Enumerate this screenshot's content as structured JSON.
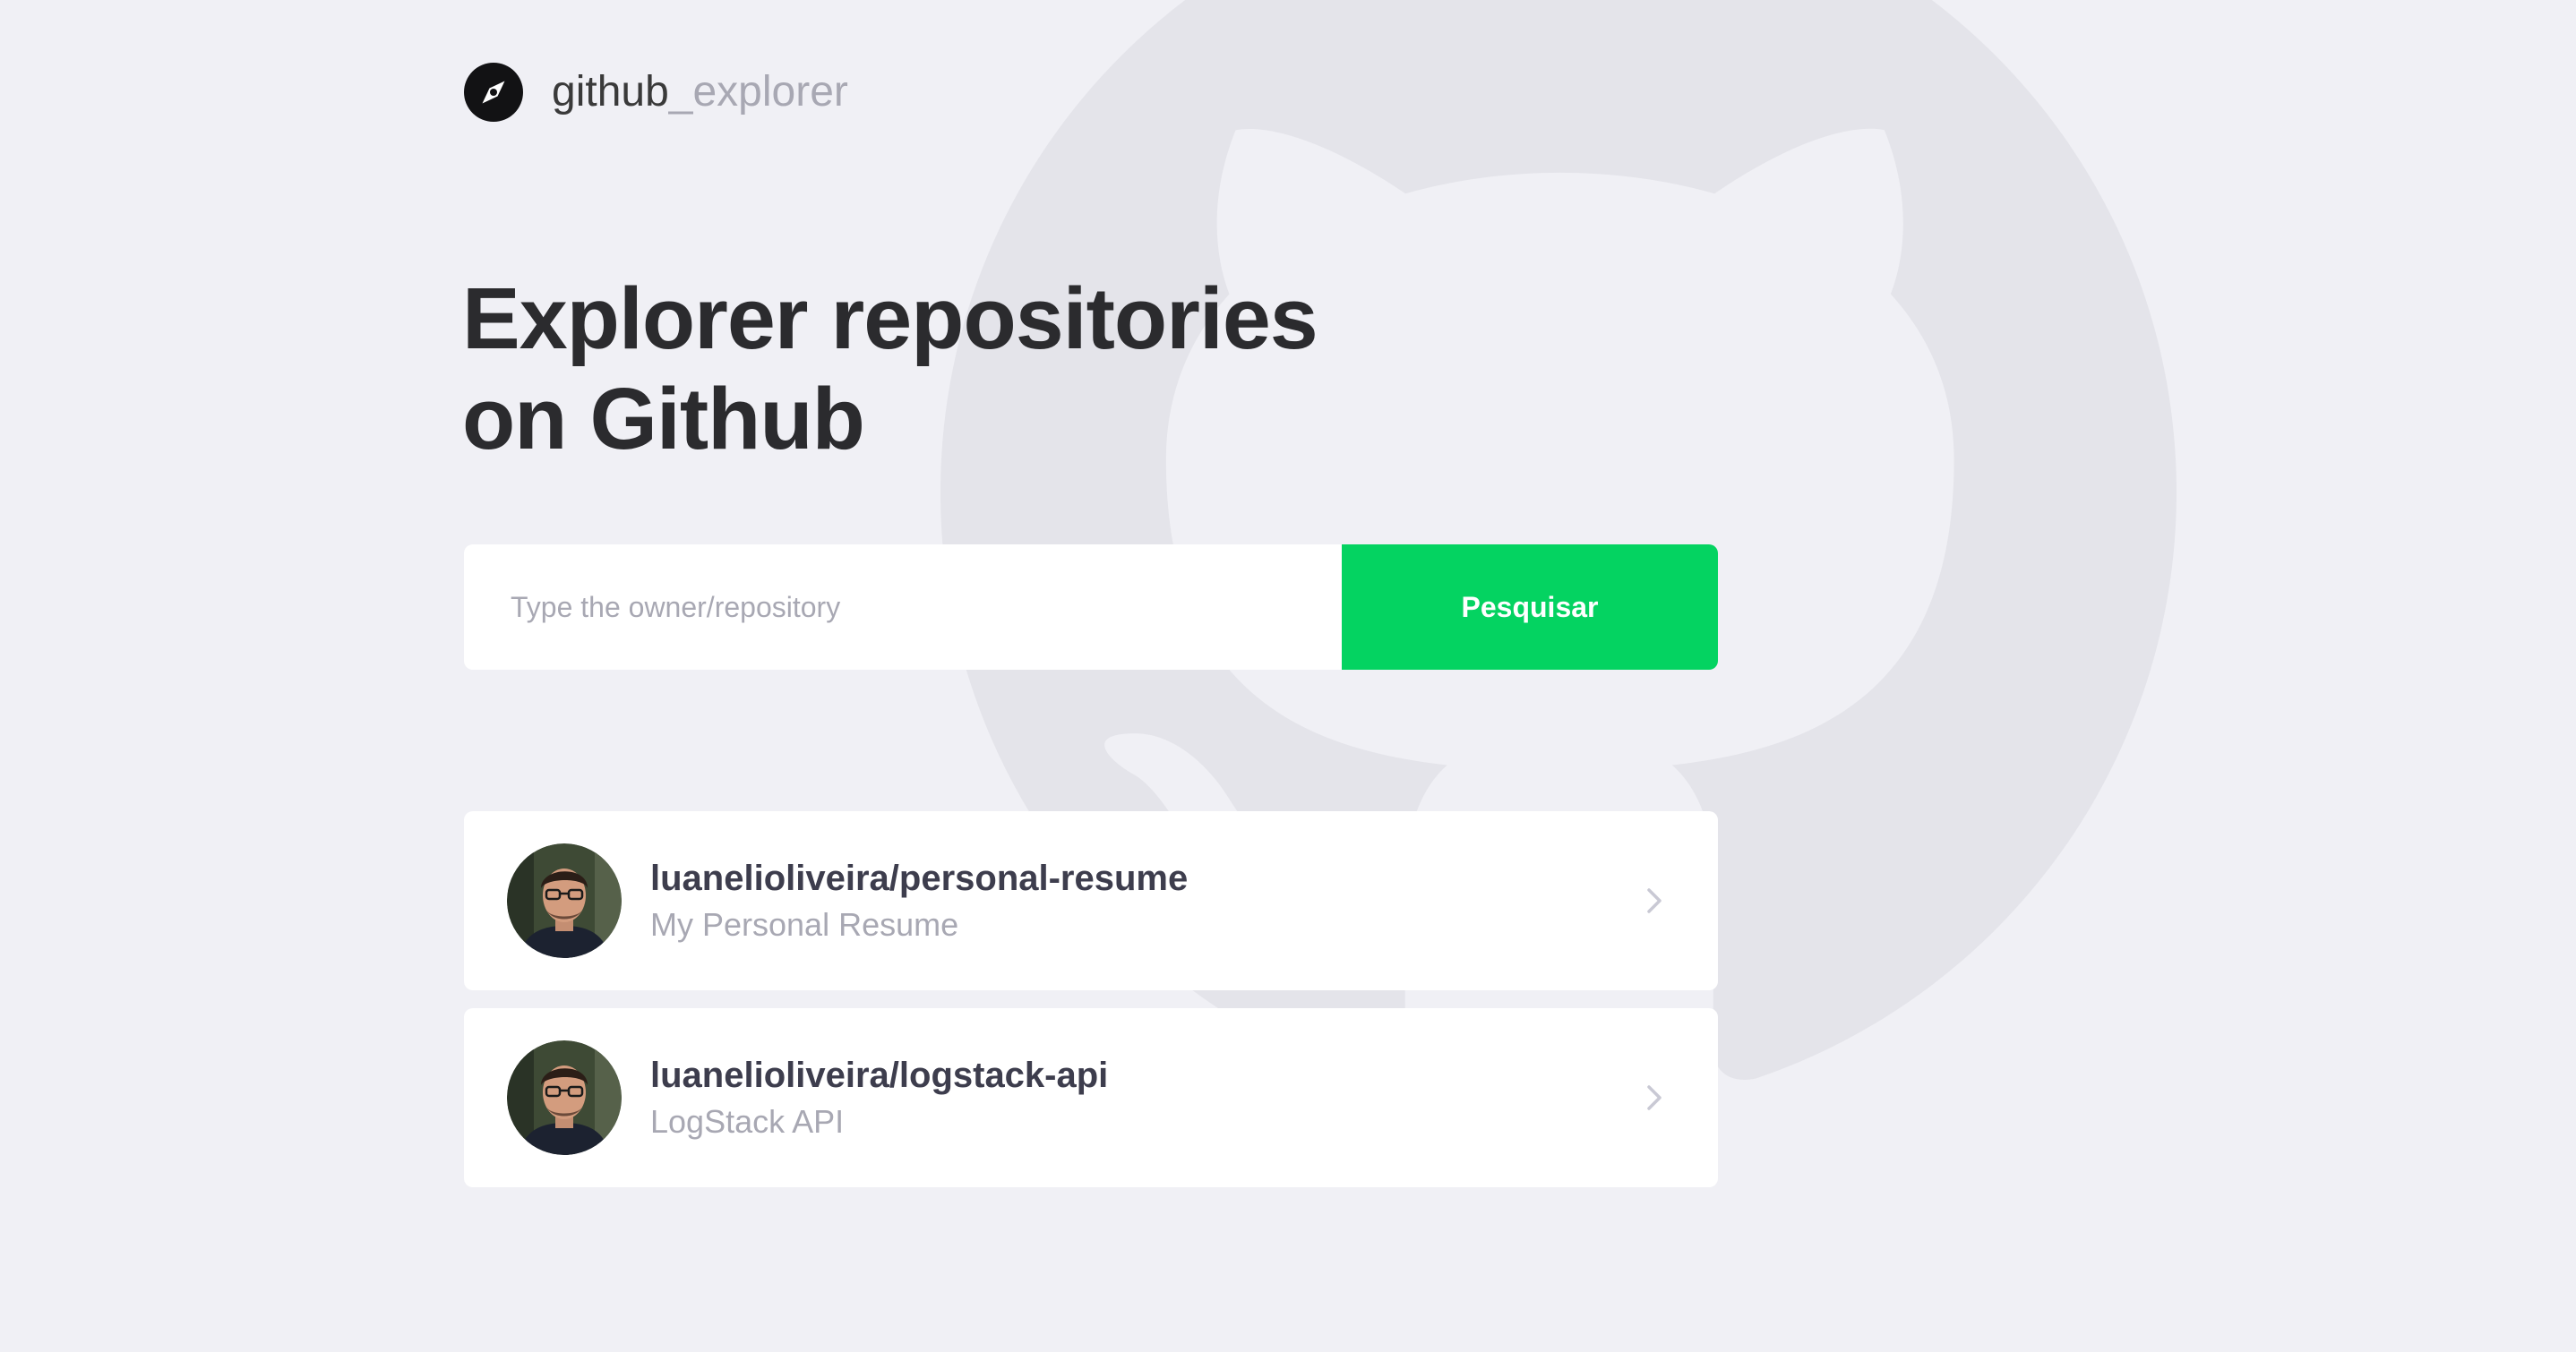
{
  "logo": {
    "text_primary": "github",
    "text_secondary": "_explorer",
    "icon": "compass-icon"
  },
  "hero": {
    "title_line1": "Explorer repositories",
    "title_line2": "on Github"
  },
  "search": {
    "placeholder": "Type the owner/repository",
    "value": "",
    "button_label": "Pesquisar"
  },
  "repositories": [
    {
      "full_name": "luanelioliveira/personal-resume",
      "description": "My Personal Resume",
      "avatar": "user-avatar",
      "icon": "chevron-right-icon"
    },
    {
      "full_name": "luanelioliveira/logstack-api",
      "description": "LogStack API",
      "avatar": "user-avatar",
      "icon": "chevron-right-icon"
    }
  ],
  "background": {
    "icon": "github-octocat-icon"
  },
  "colors": {
    "background": "#F0F0F5",
    "accent": "#04D361",
    "title": "#2B2B2E",
    "muted": "#A8A8B3",
    "repo_name": "#3D3D4D",
    "card": "#FFFFFF"
  }
}
